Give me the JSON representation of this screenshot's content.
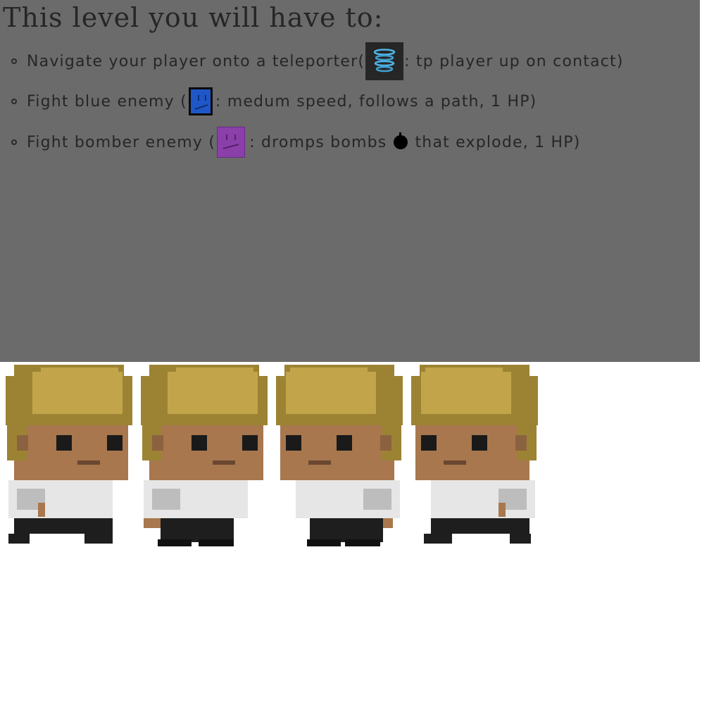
{
  "panel": {
    "title": "This level you will have to:",
    "tasks": [
      {
        "before": "Navigate your player onto a teleporter(",
        "icon": "teleporter-icon",
        "after": ": tp player up on contact)"
      },
      {
        "before": "Fight blue enemy (",
        "icon": "blue-enemy-icon",
        "after": ": medum speed, follows a path, 1 HP)"
      },
      {
        "before": "Fight bomber enemy (",
        "icon": "bomber-enemy-icon",
        "after_a": ": dromps bombs",
        "bomb_icon": "bomb-icon",
        "after_b": "that explode, 1 HP)"
      }
    ]
  },
  "sprites": {
    "icon": "player-sprite",
    "frames": 4
  },
  "colors": {
    "panel_bg": "#6b6b6b",
    "text": "#262626",
    "blue_enemy": "#1f57c8",
    "bomber_enemy": "#8b3fa8",
    "teleporter_glow": "#4fb4e6",
    "hair": "#c2a54a",
    "skin": "#a8774e",
    "shirt": "#e6e6e6",
    "pants": "#1e1e1e"
  }
}
